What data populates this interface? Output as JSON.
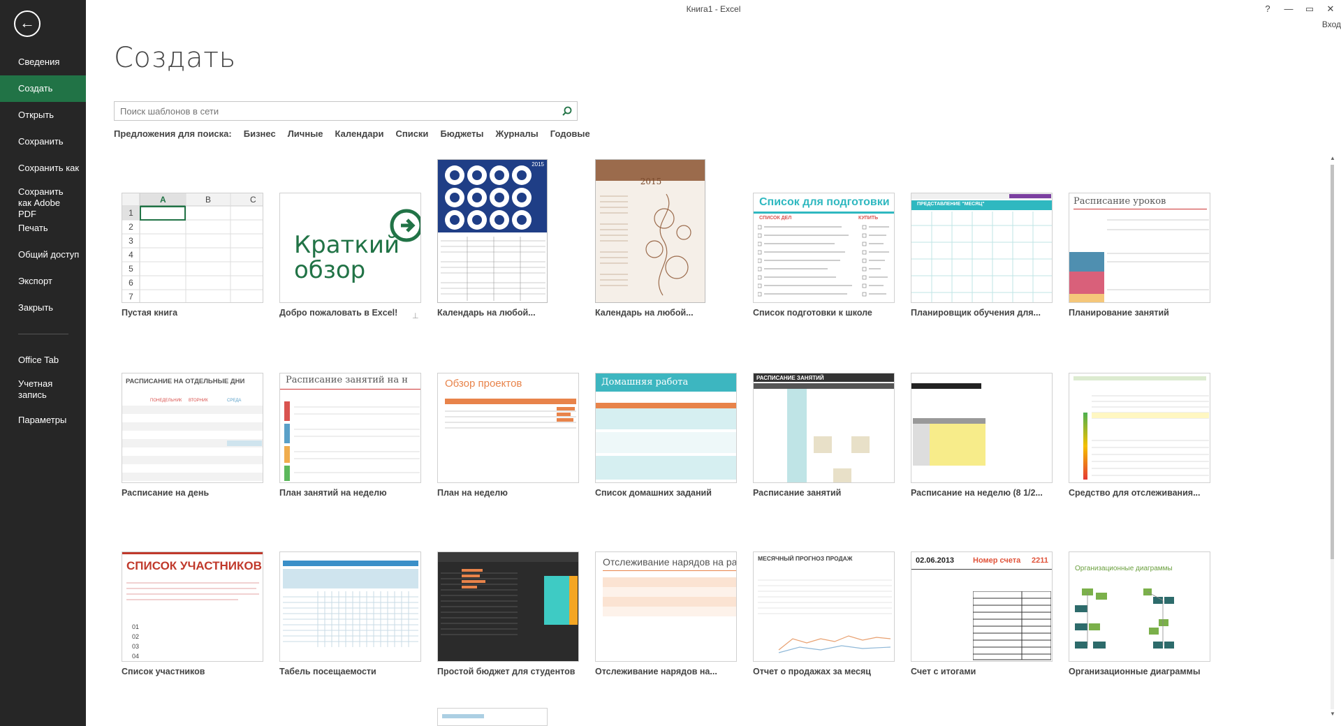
{
  "window": {
    "title": "Книга1 - Excel",
    "help": "?",
    "minimize": "—",
    "restore": "▭",
    "close": "✕",
    "signin": "Вход"
  },
  "sidebar": {
    "back": "←",
    "items": [
      {
        "label": "Сведения",
        "active": false
      },
      {
        "label": "Создать",
        "active": true
      },
      {
        "label": "Открыть",
        "active": false
      },
      {
        "label": "Сохранить",
        "active": false
      },
      {
        "label": "Сохранить как",
        "active": false
      },
      {
        "label": "Сохранить как Adobe PDF",
        "active": false
      },
      {
        "label": "Печать",
        "active": false
      },
      {
        "label": "Общий доступ",
        "active": false
      },
      {
        "label": "Экспорт",
        "active": false
      },
      {
        "label": "Закрыть",
        "active": false
      }
    ],
    "items2": [
      {
        "label": "Office Tab"
      },
      {
        "label": "Учетная запись"
      },
      {
        "label": "Параметры"
      }
    ]
  },
  "main": {
    "title": "Создать",
    "search": {
      "placeholder": "Поиск шаблонов в сети"
    },
    "suggestions_label": "Предложения для поиска:",
    "suggestions": [
      "Бизнес",
      "Личные",
      "Календари",
      "Списки",
      "Бюджеты",
      "Журналы",
      "Годовые"
    ]
  },
  "templates": [
    {
      "label": "Пустая книга",
      "thumb": {
        "cols": [
          "A",
          "B",
          "C"
        ],
        "rows": [
          "1",
          "2",
          "3",
          "4",
          "5",
          "6",
          "7"
        ]
      }
    },
    {
      "label": "Добро пожаловать в Excel!",
      "thumb": {
        "line1": "Краткий",
        "line2": "обзор"
      }
    },
    {
      "label": "Календарь на любой...",
      "thumb": {
        "year": "2015"
      }
    },
    {
      "label": "Календарь на любой...",
      "thumb": {
        "year": "2015"
      }
    },
    {
      "label": "Список подготовки к школе",
      "thumb": {
        "heading": "Список для подготовки",
        "col1": "СПИСОК ДЕЛ",
        "col2": "КУПИТЬ"
      }
    },
    {
      "label": "Планировщик обучения для...",
      "thumb": {
        "heading": "ПРЕДСТАВЛЕНИЕ \"МЕСЯЦ\""
      }
    },
    {
      "label": "Планирование занятий",
      "thumb": {
        "heading": "Расписание уроков"
      }
    },
    {
      "label": "Расписание на день",
      "thumb": {
        "heading": "РАСПИСАНИЕ НА ОТДЕЛЬНЫЕ ДНИ",
        "d1": "ПОНЕДЕЛЬНИК",
        "d2": "ВТОРНИК",
        "d3": "СРЕДА"
      }
    },
    {
      "label": "План занятий на неделю",
      "thumb": {
        "heading": "Расписание занятий на н"
      }
    },
    {
      "label": "План на неделю",
      "thumb": {
        "heading": "Обзор проектов"
      }
    },
    {
      "label": "Список домашних заданий",
      "thumb": {
        "heading": "Домашняя работа"
      }
    },
    {
      "label": "Расписание занятий",
      "thumb": {
        "heading": "РАСПИСАНИЕ ЗАНЯТИЙ"
      }
    },
    {
      "label": "Расписание на неделю (8 1/2...",
      "thumb": {}
    },
    {
      "label": "Средство для отслеживания...",
      "thumb": {}
    },
    {
      "label": "Список участников",
      "thumb": {
        "heading": "СПИСОК УЧАСТНИКОВ",
        "nums": [
          "01",
          "02",
          "03",
          "04"
        ]
      }
    },
    {
      "label": "Табель посещаемости",
      "thumb": {}
    },
    {
      "label": "Простой бюджет для студентов",
      "thumb": {}
    },
    {
      "label": "Отслеживание нарядов на...",
      "thumb": {
        "heading": "Отслеживание нарядов на ра"
      }
    },
    {
      "label": "Отчет о продажах за месяц",
      "thumb": {
        "heading": "МЕСЯЧНЫЙ ПРОГНОЗ ПРОДАЖ"
      }
    },
    {
      "label": "Счет с итогами",
      "thumb": {
        "date": "02.06.2013",
        "heading": "Номер счета",
        "num": "2211"
      }
    },
    {
      "label": "Организационные диаграммы",
      "thumb": {
        "heading": "Организационные диаграммы"
      }
    }
  ],
  "colors": {
    "accent": "#217346",
    "sidebar": "#262626"
  }
}
